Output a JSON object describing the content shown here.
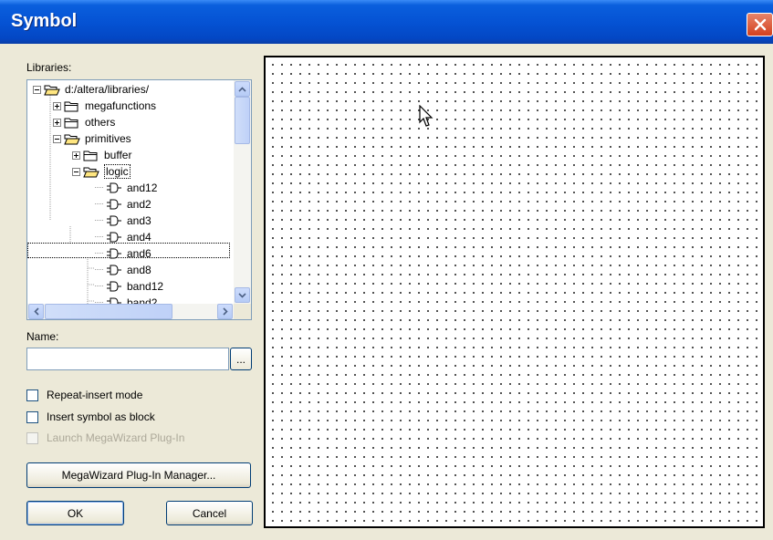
{
  "window": {
    "title": "Symbol"
  },
  "libraries": {
    "label": "Libraries:",
    "tree": [
      {
        "label": "d:/altera/libraries/",
        "kind": "folder-open",
        "expander": "minus",
        "level": 0
      },
      {
        "label": "megafunctions",
        "kind": "folder",
        "expander": "plus",
        "level": 1
      },
      {
        "label": "others",
        "kind": "folder",
        "expander": "plus",
        "level": 1
      },
      {
        "label": "primitives",
        "kind": "folder-open",
        "expander": "minus",
        "level": 1
      },
      {
        "label": "buffer",
        "kind": "folder",
        "expander": "plus",
        "level": 2
      },
      {
        "label": "logic",
        "kind": "folder-open",
        "expander": "minus",
        "level": 2,
        "selected": true
      },
      {
        "label": "and12",
        "kind": "symbol",
        "level": 3
      },
      {
        "label": "and2",
        "kind": "symbol",
        "level": 3
      },
      {
        "label": "and3",
        "kind": "symbol",
        "level": 3
      },
      {
        "label": "and4",
        "kind": "symbol",
        "level": 3
      },
      {
        "label": "and6",
        "kind": "symbol",
        "level": 3
      },
      {
        "label": "and8",
        "kind": "symbol",
        "level": 3
      },
      {
        "label": "band12",
        "kind": "symbol",
        "level": 3
      },
      {
        "label": "band2",
        "kind": "symbol",
        "level": 3
      }
    ]
  },
  "name": {
    "label": "Name:",
    "value": "",
    "browse_label": "..."
  },
  "options": {
    "repeat_insert": {
      "label": "Repeat-insert mode",
      "checked": false,
      "enabled": true
    },
    "insert_as_block": {
      "label": "Insert symbol as block",
      "checked": false,
      "enabled": true
    },
    "launch_megawizard": {
      "label": "Launch MegaWizard Plug-In",
      "checked": false,
      "enabled": false
    }
  },
  "buttons": {
    "megawizard_manager": "MegaWizard Plug-In Manager...",
    "ok": "OK",
    "cancel": "Cancel"
  },
  "icons": {
    "close": "close-x-icon",
    "folder": "folder-icon",
    "folder_open": "open-folder-icon",
    "symbol": "symbol-icon",
    "cursor": "mouse-pointer-icon"
  },
  "colors": {
    "titlebar": "#0553d4",
    "close_button": "#d3411e",
    "dialog_bg": "#ece9d8",
    "selection_border": "#000000"
  }
}
